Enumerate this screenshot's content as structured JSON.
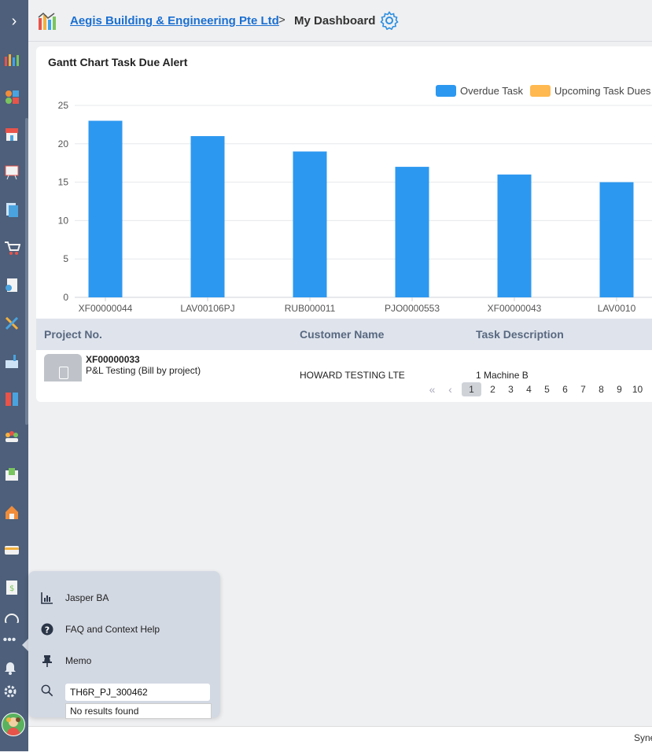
{
  "header": {
    "company": "Aegis Building & Engineering Pte Ltd",
    "separator": ">",
    "current": "My Dashboard"
  },
  "widget": {
    "title": "Gantt Chart Task Due Alert",
    "legend": [
      {
        "label": "Overdue Task",
        "color": "#2d98f0"
      },
      {
        "label": "Upcoming Task Dues I",
        "color": "#ffb950"
      }
    ]
  },
  "chart_data": {
    "type": "bar",
    "categories": [
      "XF00000044",
      "LAV00106PJ",
      "RUB000011",
      "PJO0000553",
      "XF00000043",
      "LAV0010"
    ],
    "series": [
      {
        "name": "Overdue Task",
        "values": [
          23,
          21,
          19,
          17,
          16,
          15
        ]
      }
    ],
    "yticks": [
      "0",
      "5",
      "10",
      "15",
      "20",
      "25"
    ],
    "ylim": [
      0,
      25
    ],
    "grid": true,
    "legend_position": "top-right"
  },
  "table": {
    "columns": [
      "Project No.",
      "Customer Name",
      "Task Description"
    ],
    "rows": [
      {
        "project_no": "XF00000033",
        "project_desc": "P&L Testing (Bill by project)",
        "customer": "HOWARD TESTING LTE",
        "task": "1 Machine B"
      }
    ]
  },
  "pager": {
    "first": "«",
    "prev": "‹",
    "pages": [
      "1",
      "2",
      "3",
      "4",
      "5",
      "6",
      "7",
      "8",
      "9",
      "10"
    ],
    "active": "1"
  },
  "popup": {
    "items": [
      {
        "label": "Jasper BA",
        "icon": "bar-chart-icon"
      },
      {
        "label": "FAQ and Context Help",
        "icon": "help-icon"
      },
      {
        "label": "Memo",
        "icon": "pin-icon"
      }
    ],
    "search_value": "TH6R_PJ_300462",
    "no_results": "No results found"
  },
  "footer": {
    "text": "Syne"
  }
}
